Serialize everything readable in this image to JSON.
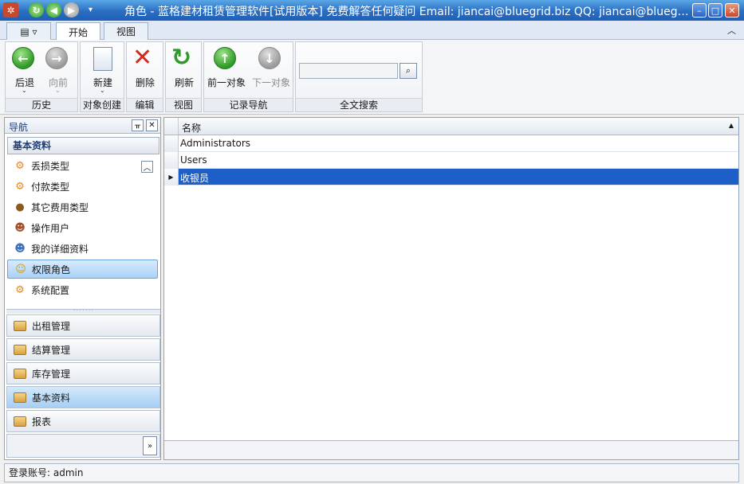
{
  "window": {
    "title": "角色 - 蓝格建材租赁管理软件[试用版本] 免费解答任何疑问 Email: jiancai@bluegrid.biz QQ: jiancai@bluegr…"
  },
  "tabs": [
    {
      "label": "开始",
      "active": true
    },
    {
      "label": "视图",
      "active": false
    }
  ],
  "ribbon": {
    "groups": {
      "history": "历史",
      "create": "对象创建",
      "edit": "编辑",
      "view": "视图",
      "recnav": "记录导航",
      "search": "全文搜索"
    },
    "buttons": {
      "back": "后退",
      "forward": "向前",
      "new": "新建",
      "delete": "删除",
      "refresh": "刷新",
      "prev": "前一对象",
      "next": "下一对象"
    },
    "search_value": ""
  },
  "nav": {
    "title": "导航",
    "group_title": "基本资料",
    "items": [
      {
        "label": "丢损类型",
        "icon": "gear-icon"
      },
      {
        "label": "付款类型",
        "icon": "gear-icon"
      },
      {
        "label": "其它费用类型",
        "icon": "money-bag-icon"
      },
      {
        "label": "操作用户",
        "icon": "user-icon"
      },
      {
        "label": "我的详细资料",
        "icon": "user-icon"
      },
      {
        "label": "权限角色",
        "icon": "mask-icon",
        "selected": true
      },
      {
        "label": "系统配置",
        "icon": "gear-icon"
      }
    ],
    "bars": [
      {
        "label": "出租管理"
      },
      {
        "label": "结算管理"
      },
      {
        "label": "库存管理"
      },
      {
        "label": "基本资料",
        "selected": true
      },
      {
        "label": "报表"
      }
    ]
  },
  "grid": {
    "column": "名称",
    "rows": [
      "Administrators",
      "Users",
      "收银员"
    ],
    "selected_index": 2
  },
  "status": {
    "text": "登录账号: admin"
  },
  "colors": {
    "title_bar": "#2a6ec2",
    "selection": "#1e5fc7",
    "nav_selected": "#a9d2f7"
  }
}
